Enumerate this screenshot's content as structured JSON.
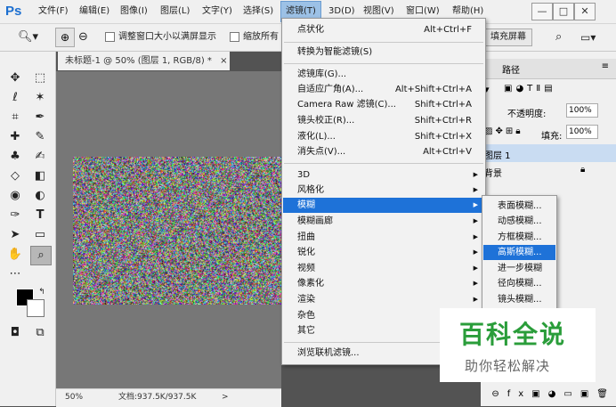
{
  "app": {
    "logo": "Ps"
  },
  "menubar": {
    "items": [
      "文件(F)",
      "编辑(E)",
      "图像(I)",
      "图层(L)",
      "文字(Y)",
      "选择(S)",
      "滤镜(T)",
      "3D(D)",
      "视图(V)",
      "窗口(W)",
      "帮助(H)"
    ],
    "active": "滤镜(T)"
  },
  "window_controls": {
    "minimize": "—",
    "maximize": "□",
    "close": "✕"
  },
  "options_bar": {
    "resize_window_label": "调整窗口大小以满屏显示",
    "zoom_all_label": "缩放所有",
    "fill_screen_label": "填充屏幕"
  },
  "document": {
    "tab_title": "未标题-1 @ 50% (图层 1, RGB/8) *",
    "tab_close": "×",
    "zoom_level": "50%",
    "doc_size": "文档:937.5K/937.5K",
    "status_arrow": ">"
  },
  "panel": {
    "tab_paths": "路径",
    "opacity_label": "不透明度:",
    "opacity_value": "100%",
    "fill_label": "填充:",
    "fill_value": "100%",
    "layer_1": "图层 1",
    "layer_bg": "背景"
  },
  "filter_menu": {
    "group1": [
      {
        "label": "点状化",
        "shortcut": "Alt+Ctrl+F"
      }
    ],
    "group2": [
      {
        "label": "转换为智能滤镜(S)",
        "shortcut": ""
      }
    ],
    "group3": [
      {
        "label": "滤镜库(G)...",
        "shortcut": ""
      },
      {
        "label": "自适应广角(A)...",
        "shortcut": "Alt+Shift+Ctrl+A"
      },
      {
        "label": "Camera Raw 滤镜(C)...",
        "shortcut": "Shift+Ctrl+A"
      },
      {
        "label": "镜头校正(R)...",
        "shortcut": "Shift+Ctrl+R"
      },
      {
        "label": "液化(L)...",
        "shortcut": "Shift+Ctrl+X"
      },
      {
        "label": "消失点(V)...",
        "shortcut": "Alt+Ctrl+V"
      }
    ],
    "group4": [
      {
        "label": "3D",
        "sub": true
      },
      {
        "label": "风格化",
        "sub": true
      },
      {
        "label": "模糊",
        "sub": true,
        "highlighted": true
      },
      {
        "label": "模糊画廊",
        "sub": true
      },
      {
        "label": "扭曲",
        "sub": true
      },
      {
        "label": "锐化",
        "sub": true
      },
      {
        "label": "视频",
        "sub": true
      },
      {
        "label": "像素化",
        "sub": true
      },
      {
        "label": "渲染",
        "sub": true
      },
      {
        "label": "杂色",
        "sub": true
      },
      {
        "label": "其它",
        "sub": true
      }
    ],
    "group5": [
      {
        "label": "浏览联机滤镜...",
        "shortcut": ""
      }
    ]
  },
  "blur_submenu": [
    {
      "label": "表面模糊..."
    },
    {
      "label": "动感模糊..."
    },
    {
      "label": "方框模糊..."
    },
    {
      "label": "高斯模糊...",
      "highlighted": true
    },
    {
      "label": "进一步模糊"
    },
    {
      "label": "径向模糊..."
    },
    {
      "label": "镜头模糊..."
    }
  ],
  "watermark": {
    "title": "百科全说",
    "subtitle": "助你轻松解决"
  },
  "colors": {
    "accent": "#1e72d8",
    "watermark_green": "#2a9d3a"
  }
}
